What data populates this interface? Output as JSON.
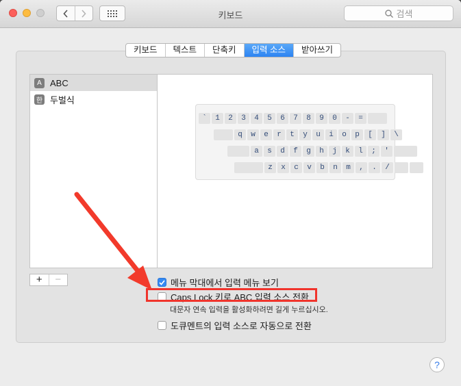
{
  "window": {
    "title": "키보드"
  },
  "toolbar": {
    "back_glyph": "‹",
    "forward_glyph": "›",
    "search_placeholder": "검색"
  },
  "tabs": [
    {
      "label": "키보드",
      "active": false
    },
    {
      "label": "텍스트",
      "active": false
    },
    {
      "label": "단축키",
      "active": false
    },
    {
      "label": "입력 소스",
      "active": true
    },
    {
      "label": "받아쓰기",
      "active": false
    }
  ],
  "sources": [
    {
      "badge": "A",
      "label": "ABC",
      "selected": true
    },
    {
      "badge": "한",
      "label": "두벌식",
      "selected": false
    }
  ],
  "keyboard_rows": [
    [
      "`",
      "1",
      "2",
      "3",
      "4",
      "5",
      "6",
      "7",
      "8",
      "9",
      "0",
      "-",
      "="
    ],
    [
      "q",
      "w",
      "e",
      "r",
      "t",
      "y",
      "u",
      "i",
      "o",
      "p",
      "[",
      "]",
      "\\"
    ],
    [
      "a",
      "s",
      "d",
      "f",
      "g",
      "h",
      "j",
      "k",
      "l",
      ";",
      "'"
    ],
    [
      "z",
      "x",
      "c",
      "v",
      "b",
      "n",
      "m",
      ",",
      ".",
      "/"
    ]
  ],
  "controls": {
    "add_label": "+",
    "remove_label": "−"
  },
  "options": {
    "show_menu": {
      "label": "메뉴 막대에서 입력 메뉴 보기",
      "checked": true
    },
    "caps_lock": {
      "label": "Caps Lock 키로 ABC 입력 소스 전환",
      "checked": false
    },
    "caps_lock_hint": "대문자 연속 입력을 활성화하려면 길게 누르십시오.",
    "auto_switch": {
      "label": "도큐멘트의 입력 소스로 자동으로 전환",
      "checked": false
    }
  },
  "help_label": "?",
  "colors": {
    "accent": "#2d84f2",
    "highlight": "#f0342c",
    "key_text": "#334c78"
  }
}
